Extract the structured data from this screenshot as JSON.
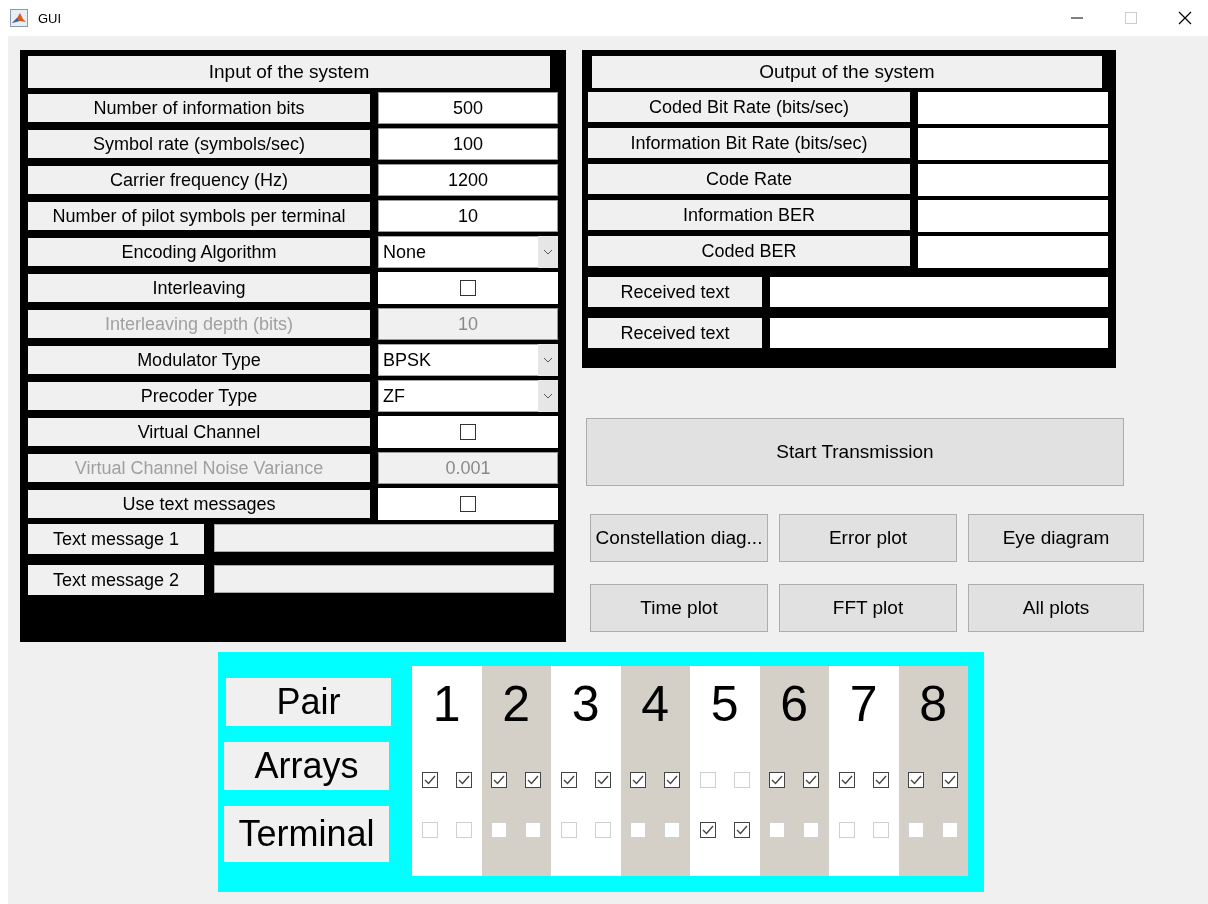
{
  "window": {
    "title": "GUI"
  },
  "input_panel": {
    "title": "Input of the system",
    "rows": [
      {
        "kind": "field",
        "label": "Number of information bits",
        "value": "500",
        "disabled": false
      },
      {
        "kind": "field",
        "label": "Symbol rate (symbols/sec)",
        "value": "100",
        "disabled": false
      },
      {
        "kind": "field",
        "label": "Carrier frequency (Hz)",
        "value": "1200",
        "disabled": false
      },
      {
        "kind": "field",
        "label": "Number of pilot symbols per terminal",
        "value": "10",
        "disabled": false
      },
      {
        "kind": "dropdown",
        "label": "Encoding Algorithm",
        "value": "None",
        "disabled": false
      },
      {
        "kind": "checkbox",
        "label": "Interleaving",
        "checked": false,
        "disabled": false
      },
      {
        "kind": "field",
        "label": "Interleaving depth (bits)",
        "value": "10",
        "disabled": true
      },
      {
        "kind": "dropdown",
        "label": "Modulator Type",
        "value": "BPSK",
        "disabled": false
      },
      {
        "kind": "dropdown",
        "label": "Precoder Type",
        "value": "ZF",
        "disabled": false
      },
      {
        "kind": "checkbox",
        "label": "Virtual Channel",
        "checked": false,
        "disabled": false
      },
      {
        "kind": "field",
        "label": "Virtual Channel Noise Variance",
        "value": "0.001",
        "disabled": true
      },
      {
        "kind": "checkbox",
        "label": "Use text messages",
        "checked": false,
        "disabled": false
      }
    ],
    "messages": [
      {
        "label": "Text message 1"
      },
      {
        "label": "Text message 2"
      }
    ]
  },
  "output_panel": {
    "title": "Output of the system",
    "rows": [
      {
        "label": "Coded Bit Rate (bits/sec)"
      },
      {
        "label": "Information Bit Rate (bits/sec)"
      },
      {
        "label": "Code Rate"
      },
      {
        "label": "Information BER"
      },
      {
        "label": "Coded BER"
      }
    ],
    "received": [
      {
        "label": "Received text"
      },
      {
        "label": "Received text"
      }
    ]
  },
  "start_button": "Start Transmission",
  "plot_buttons": [
    "Constellation diag...",
    "Error plot",
    "Eye diagram",
    "Time plot",
    "FFT plot",
    "All plots"
  ],
  "pair_panel": {
    "labels": [
      "Pair",
      "Arrays",
      "Terminal"
    ],
    "pairs": [
      {
        "number": "1",
        "shaded": false,
        "arrays": [
          {
            "checked": true,
            "disabled": false
          },
          {
            "checked": true,
            "disabled": false
          }
        ],
        "terminal": [
          {
            "checked": false,
            "disabled": true
          },
          {
            "checked": false,
            "disabled": true
          }
        ]
      },
      {
        "number": "2",
        "shaded": true,
        "arrays": [
          {
            "checked": true,
            "disabled": false
          },
          {
            "checked": true,
            "disabled": false
          }
        ],
        "terminal": [
          {
            "checked": false,
            "disabled": true
          },
          {
            "checked": false,
            "disabled": true
          }
        ]
      },
      {
        "number": "3",
        "shaded": false,
        "arrays": [
          {
            "checked": true,
            "disabled": false
          },
          {
            "checked": true,
            "disabled": false
          }
        ],
        "terminal": [
          {
            "checked": false,
            "disabled": true
          },
          {
            "checked": false,
            "disabled": true
          }
        ]
      },
      {
        "number": "4",
        "shaded": true,
        "arrays": [
          {
            "checked": true,
            "disabled": false
          },
          {
            "checked": true,
            "disabled": false
          }
        ],
        "terminal": [
          {
            "checked": false,
            "disabled": true
          },
          {
            "checked": false,
            "disabled": true
          }
        ]
      },
      {
        "number": "5",
        "shaded": false,
        "arrays": [
          {
            "checked": false,
            "disabled": true
          },
          {
            "checked": false,
            "disabled": true
          }
        ],
        "terminal": [
          {
            "checked": true,
            "disabled": false
          },
          {
            "checked": true,
            "disabled": false
          }
        ]
      },
      {
        "number": "6",
        "shaded": true,
        "arrays": [
          {
            "checked": true,
            "disabled": false
          },
          {
            "checked": true,
            "disabled": false
          }
        ],
        "terminal": [
          {
            "checked": false,
            "disabled": true
          },
          {
            "checked": false,
            "disabled": true
          }
        ]
      },
      {
        "number": "7",
        "shaded": false,
        "arrays": [
          {
            "checked": true,
            "disabled": false
          },
          {
            "checked": true,
            "disabled": false
          }
        ],
        "terminal": [
          {
            "checked": false,
            "disabled": true
          },
          {
            "checked": false,
            "disabled": true
          }
        ]
      },
      {
        "number": "8",
        "shaded": true,
        "arrays": [
          {
            "checked": true,
            "disabled": false
          },
          {
            "checked": true,
            "disabled": false
          }
        ],
        "terminal": [
          {
            "checked": false,
            "disabled": true
          },
          {
            "checked": false,
            "disabled": true
          }
        ]
      }
    ]
  }
}
